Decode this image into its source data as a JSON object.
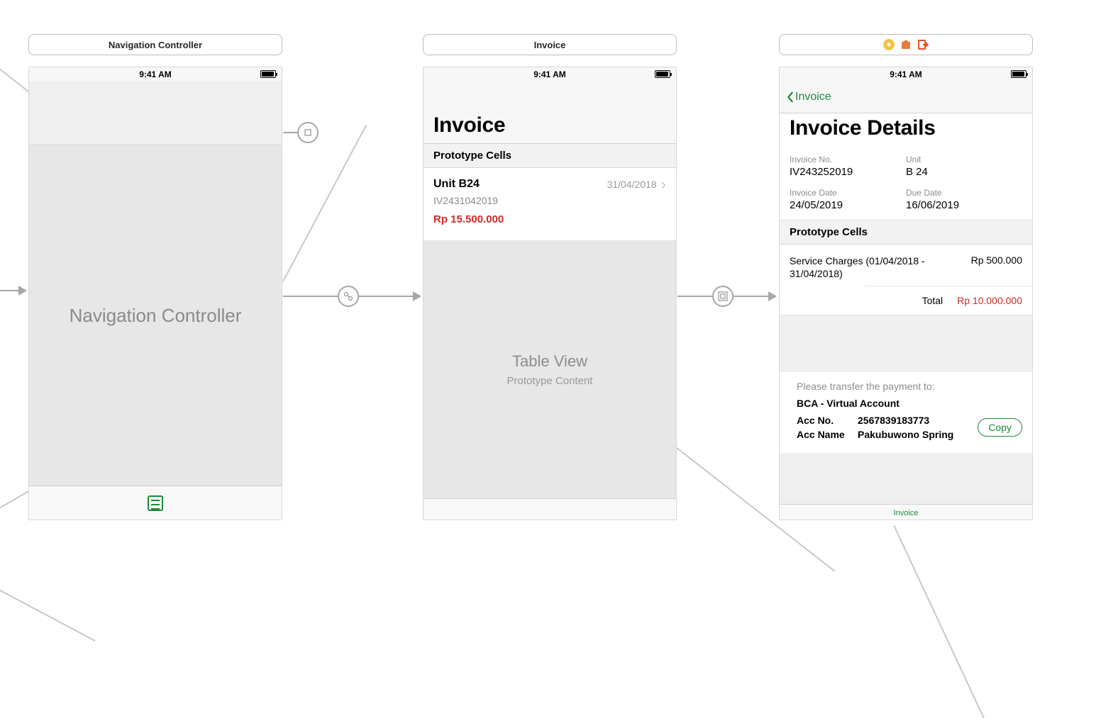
{
  "statusbar": {
    "time": "9:41 AM"
  },
  "scenes": {
    "nav": {
      "title": "Navigation Controller",
      "placeholder": "Navigation Controller"
    },
    "invoice": {
      "title": "Invoice",
      "large_title": "Invoice",
      "prototype_header": "Prototype Cells",
      "cell": {
        "unit": "Unit B24",
        "invoice_no": "IV2431042019",
        "date": "31/04/2018",
        "amount": "Rp 15.500.000"
      },
      "tableview": {
        "title": "Table View",
        "subtitle": "Prototype Content"
      }
    },
    "details": {
      "back_label": "Invoice",
      "large_title": "Invoice Details",
      "fields": {
        "invoice_no_label": "Invoice No.",
        "invoice_no": "IV243252019",
        "unit_label": "Unit",
        "unit": "B 24",
        "invoice_date_label": "Invoice Date",
        "invoice_date": "24/05/2019",
        "due_date_label": "Due Date",
        "due_date": "16/06/2019"
      },
      "prototype_header": "Prototype Cells",
      "charge": {
        "desc": "Service Charges (01/04/2018 - 31/04/2018)",
        "amount": "Rp 500.000"
      },
      "total": {
        "label": "Total",
        "value": "Rp 10.000.000"
      },
      "payment": {
        "hint": "Please transfer the payment to:",
        "bank": "BCA - Virtual Account",
        "acc_no_label": "Acc No.",
        "acc_no": "2567839183773",
        "acc_name_label": "Acc Name",
        "acc_name": "Pakubuwono Spring",
        "copy_button": "Copy"
      },
      "bottom_tab": "Invoice"
    }
  }
}
